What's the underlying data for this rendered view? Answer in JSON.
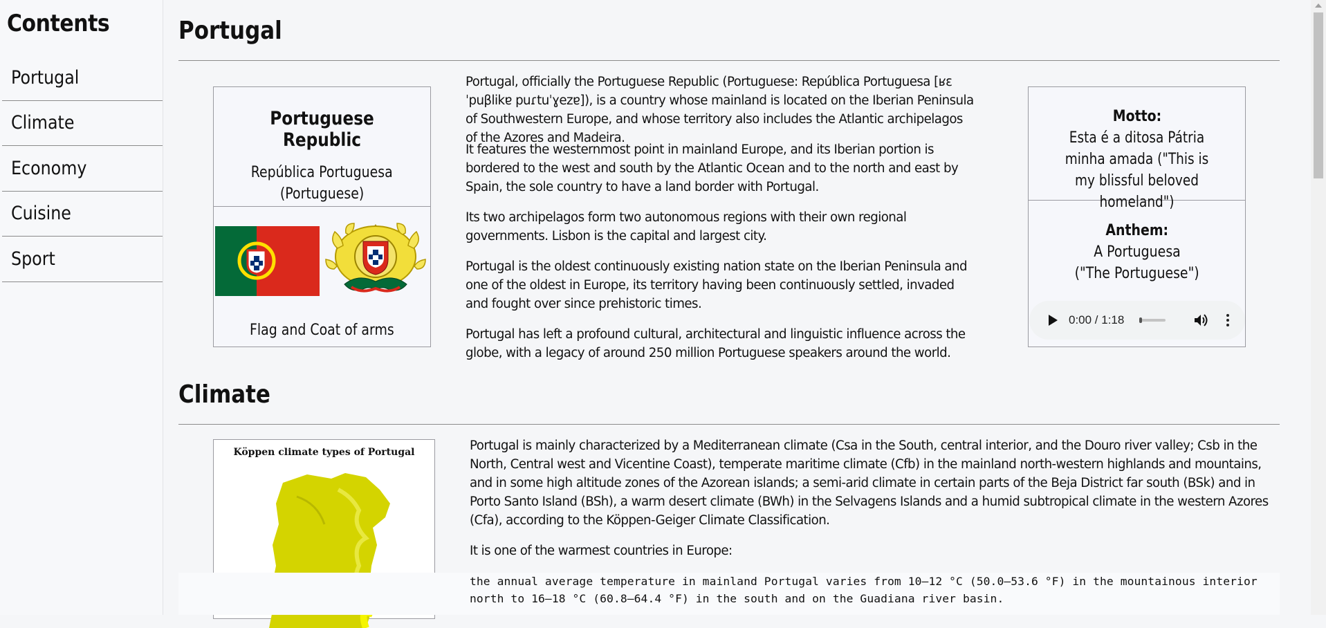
{
  "sidebar": {
    "title": "Contents",
    "items": [
      {
        "label": "Portugal"
      },
      {
        "label": "Climate"
      },
      {
        "label": "Economy"
      },
      {
        "label": "Cuisine"
      },
      {
        "label": "Sport"
      }
    ]
  },
  "portugal": {
    "heading": "Portugal",
    "infobox": {
      "name": "Portuguese Republic",
      "native_name": "República Portuguesa",
      "native_lang": "(Portuguese)",
      "flag_caption": "Flag and Coat of arms"
    },
    "paragraphs": [
      "Portugal, officially the Portuguese Republic (Portuguese: República Portuguesa [ʁɛˈpuβlikɐ puɾtuˈɣezɐ]), is a country whose mainland is located on the Iberian Peninsula of Southwestern Europe, and whose territory also includes the Atlantic archipelagos of the Azores and Madeira.",
      "It features the westernmost point in mainland Europe, and its Iberian portion is bordered to the west and south by the Atlantic Ocean and to the north and east by Spain, the sole country to have a land border with Portugal.",
      "Its two archipelagos form two autonomous regions with their own regional governments. Lisbon is the capital and largest city.",
      "Portugal is the oldest continuously existing nation state on the Iberian Peninsula and one of the oldest in Europe, its territory having been continuously settled, invaded and fought over since prehistoric times.",
      "Portugal has left a profound cultural, architectural and linguistic influence across the globe, with a legacy of around 250 million Portuguese speakers around the world."
    ],
    "motto_box": {
      "motto_label": "Motto:",
      "motto_text": "Esta é a ditosa Pátria minha amada (\"This is my blissful beloved homeland\")",
      "anthem_label": "Anthem:",
      "anthem_name": "A Portuguesa",
      "anthem_translation": "(\"The Portuguese\")",
      "audio_time": "0:00 / 1:18",
      "audio_progress": 0
    }
  },
  "climate": {
    "heading": "Climate",
    "map_title": "Köppen climate types of Portugal",
    "paragraphs": [
      "Portugal is mainly characterized by a Mediterranean climate (Csa in the South, central interior, and the Douro river valley; Csb in the North, Central west and Vicentine Coast), temperate maritime climate (Cfb) in the mainland north-western highlands and mountains, and in some high altitude zones of the Azorean islands; a semi-arid climate in certain parts of the Beja District far south (BSk) and in Porto Santo Island (BSh), a warm desert climate (BWh) in the Selvagens Islands and a humid subtropical climate in the western Azores (Cfa), according to the Köppen-Geiger Climate Classification.",
      "It is one of the warmest countries in Europe:"
    ],
    "code_lines": [
      "the annual average temperature in mainland Portugal varies from 10–12 °C (50.0–53.6 °F) in the mountainous interior",
      "north to 16–18 °C (60.8–64.4 °F) in the south and on the Guadiana river basin."
    ]
  },
  "colors": {
    "flag_green": "#046a38",
    "flag_red": "#da291c",
    "map_yellow": "#d4d400"
  }
}
